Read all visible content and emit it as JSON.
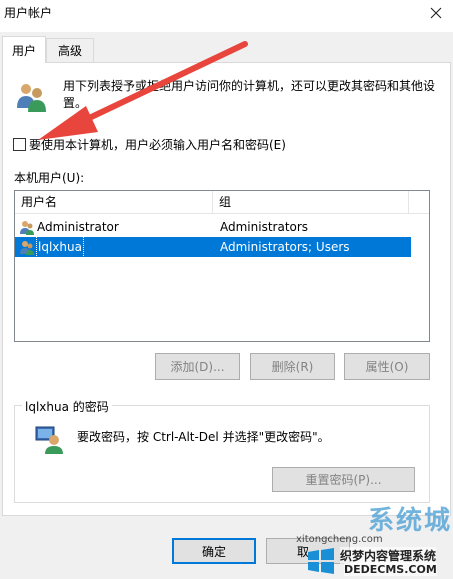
{
  "window": {
    "title": "用户帐户",
    "close_icon": "close-icon"
  },
  "tabs": [
    {
      "label": "用户",
      "selected": true
    },
    {
      "label": "高级",
      "selected": false
    }
  ],
  "intro": {
    "text": "用下列表授予或拒绝用户访问你的计算机，还可以更改其密码和其他设置。",
    "icon": "users-icon"
  },
  "require_login": {
    "label": "要使用本计算机，用户必须输入用户名和密码(E)",
    "checked": false
  },
  "local_users": {
    "label": "本机用户(U):",
    "columns": [
      "用户名",
      "组"
    ],
    "rows": [
      {
        "name": "Administrator",
        "group": "Administrators",
        "selected": false
      },
      {
        "name": "lqlxhua",
        "group": "Administrators; Users",
        "selected": true
      }
    ]
  },
  "user_buttons": {
    "add": "添加(D)...",
    "remove": "删除(R)",
    "properties": "属性(O)"
  },
  "password_group": {
    "legend": "lqlxhua 的密码",
    "text": "要改密码，按 Ctrl-Alt-Del 并选择\"更改密码\"。",
    "reset_button": "重置密码(P)..."
  },
  "dialog_buttons": {
    "ok": "确定",
    "cancel": "取"
  },
  "watermark": {
    "big": "系统城",
    "url1": "xitongcheng.com",
    "line1": "织梦内容管理系统",
    "line2": "DEDECMS.COM"
  },
  "colors": {
    "selection": "#0078d7",
    "arrow": "#e8453c",
    "dialog_bg": "#f0f0f0"
  }
}
